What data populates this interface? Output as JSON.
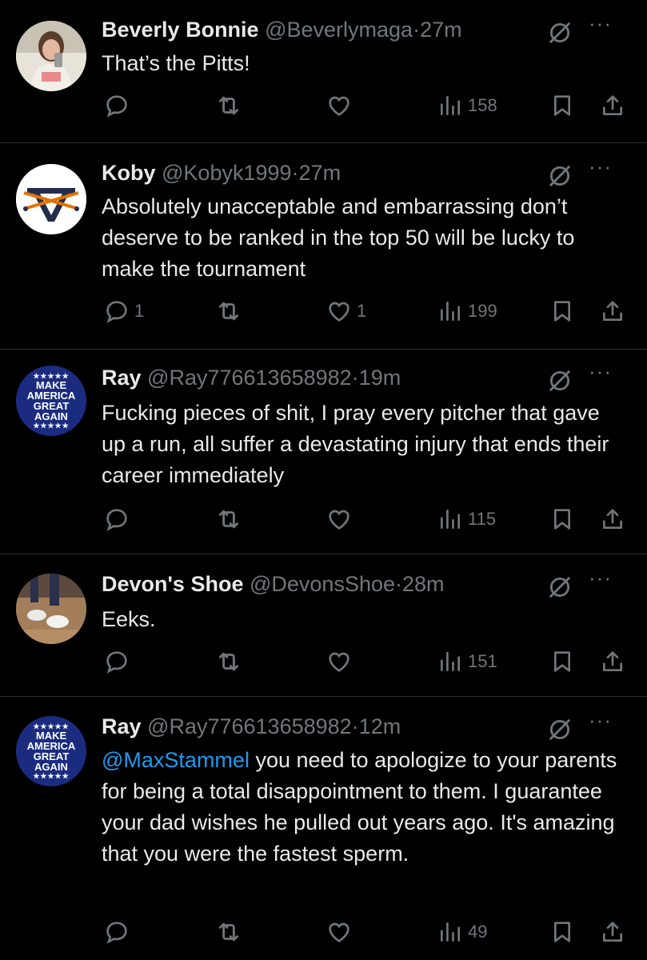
{
  "tweets": [
    {
      "name": "Beverly Bonnie",
      "handle": "@Beverlymaga",
      "time": "27m",
      "text": "That’s the Pitts!",
      "replies": "",
      "likes": "",
      "views": "158",
      "avatar": "photo-person"
    },
    {
      "name": "Koby",
      "handle": "@Kobyk1999",
      "time": "27m",
      "text": "Absolutely unacceptable and embarrassing don’t deserve to be ranked in the top 50 will be lucky to make the tournament",
      "replies": "1",
      "likes": "1",
      "views": "199",
      "avatar": "v-sabres-logo"
    },
    {
      "name": "Ray",
      "handle": "@Ray776613658982",
      "time": "19m",
      "text": "Fucking pieces of shit, I pray every pitcher that gave up a run, all suffer a devastating injury that ends their career immediately",
      "replies": "",
      "likes": "",
      "views": "115",
      "avatar": "maga-badge",
      "avatar_text": [
        "MAKE",
        "AMERICA",
        "GREAT",
        "AGAIN"
      ]
    },
    {
      "name": "Devon's Shoe",
      "handle": "@DevonsShoe",
      "time": "28m",
      "text": "Eeks.",
      "replies": "",
      "likes": "",
      "views": "151",
      "avatar": "photo-shoe"
    },
    {
      "name": "Ray",
      "handle": "@Ray776613658982",
      "time": "12m",
      "mention": "@MaxStammel",
      "text": " you need to apologize to your parents for being a total disappointment to them. I guarantee your dad wishes he pulled out years ago. It's amazing that you were the fastest sperm.",
      "replies": "",
      "likes": "",
      "views": "49",
      "avatar": "maga-badge",
      "avatar_text": [
        "MAKE",
        "AMERICA",
        "GREAT",
        "AGAIN"
      ]
    }
  ],
  "separator": "·",
  "more_glyph": "···",
  "colors": {
    "background": "#000000",
    "text": "#e7e9ea",
    "muted": "#71767b",
    "link": "#1d9bf0",
    "divider": "#2f3336"
  }
}
